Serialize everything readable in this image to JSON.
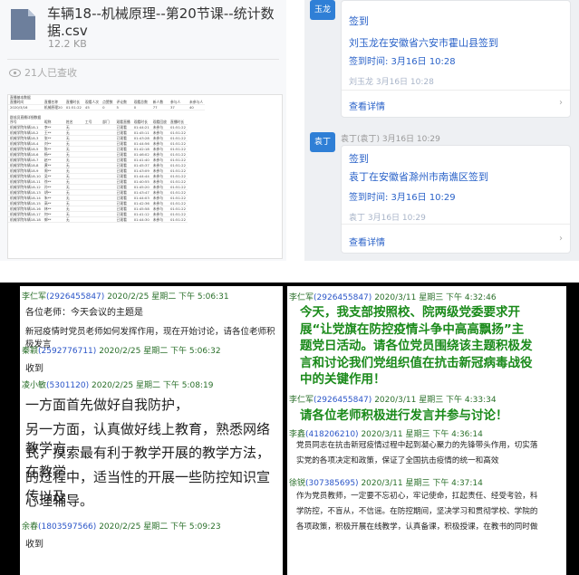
{
  "file_card": {
    "title": "车辆18--机械原理--第20节课--统计数据.csv",
    "size": "12.2 KB",
    "viewed": "21人已查收",
    "icon": "document-icon"
  },
  "spreadsheet": {
    "section1_title": "直播基本数据",
    "header1": [
      "直播时间",
      "直播名称",
      "直播时长",
      "观看人次",
      "点赞数",
      "评论数",
      "观看总数",
      "新人数",
      "参与人",
      "未参与人"
    ],
    "row1": [
      "2020/3/16",
      "机械原理20",
      "01:51:22",
      "45",
      "0",
      "5",
      "0",
      "77",
      "37",
      "40"
    ],
    "section2_title": "群成员直播详细数据",
    "header2": [
      "序号",
      "昵称",
      "姓名",
      "工号",
      "部门",
      "观看直播",
      "观看时长",
      "观看回放",
      "直播时长"
    ],
    "rows2": [
      [
        "机械学院车辆18-1",
        "李**",
        "无",
        "",
        "",
        "已观看",
        "01:44:21",
        "未参与",
        "01:51:22"
      ],
      [
        "机械学院车辆18-2",
        "王**",
        "无",
        "",
        "",
        "已观看",
        "01:45:11",
        "未参与",
        "01:51:22"
      ],
      [
        "机械学院车辆18-3",
        "张**",
        "无",
        "",
        "",
        "已观看",
        "01:43:28",
        "未参与",
        "01:51:22"
      ],
      [
        "机械学院车辆18-4",
        "刘**",
        "无",
        "",
        "",
        "已观看",
        "01:44:56",
        "未参与",
        "01:51:22"
      ],
      [
        "机械学院车辆18-5",
        "陈**",
        "无",
        "",
        "",
        "已观看",
        "01:42:18",
        "未参与",
        "01:51:22"
      ],
      [
        "机械学院车辆18-6",
        "杨**",
        "无",
        "",
        "",
        "已观看",
        "01:46:02",
        "未参与",
        "01:51:22"
      ],
      [
        "机械学院车辆18-7",
        "赵**",
        "无",
        "",
        "",
        "已观看",
        "01:41:40",
        "未参与",
        "01:51:22"
      ],
      [
        "机械学院车辆18-8",
        "黄**",
        "无",
        "",
        "",
        "已观看",
        "01:45:37",
        "未参与",
        "01:51:22"
      ],
      [
        "机械学院车辆18-9",
        "周**",
        "无",
        "",
        "",
        "已观看",
        "01:43:09",
        "未参与",
        "01:51:22"
      ],
      [
        "机械学院车辆18-10",
        "吴**",
        "无",
        "",
        "",
        "已观看",
        "01:44:44",
        "未参与",
        "01:51:22"
      ],
      [
        "机械学院车辆18-11",
        "徐**",
        "无",
        "",
        "",
        "已观看",
        "01:40:55",
        "未参与",
        "01:51:22"
      ],
      [
        "机械学院车辆18-12",
        "孙**",
        "无",
        "",
        "",
        "已观看",
        "01:45:20",
        "未参与",
        "01:51:22"
      ],
      [
        "机械学院车辆18-13",
        "胡**",
        "无",
        "",
        "",
        "已观看",
        "01:43:47",
        "未参与",
        "01:51:22"
      ],
      [
        "机械学院车辆18-14",
        "朱**",
        "无",
        "",
        "",
        "已观看",
        "01:44:03",
        "未参与",
        "01:51:22"
      ],
      [
        "机械学院车辆18-15",
        "高**",
        "无",
        "",
        "",
        "已观看",
        "01:42:36",
        "未参与",
        "01:51:22"
      ],
      [
        "机械学院车辆18-16",
        "林**",
        "无",
        "",
        "",
        "已观看",
        "01:45:58",
        "未参与",
        "01:51:22"
      ],
      [
        "机械学院车辆18-17",
        "何**",
        "无",
        "",
        "",
        "已观看",
        "01:41:12",
        "未参与",
        "01:51:22"
      ],
      [
        "机械学院车辆18-18",
        "郭**",
        "无",
        "",
        "",
        "已观看",
        "01:44:30",
        "未参与",
        "01:51:22"
      ]
    ]
  },
  "signin_cards": [
    {
      "avatar": "玉龙",
      "title": "签到",
      "main": "刘玉龙在安徽省六安市霍山县签到",
      "time": "签到时间: 3月16日 10:28",
      "time2": "刘玉龙 3月16日 10:28",
      "link": "查看详情"
    },
    {
      "avatar": "袁丁",
      "sender": "袁丁(袁丁)  3月16日 10:29",
      "title": "签到",
      "main": "袁丁在安徽省滁州市南谯区签到",
      "time": "签到时间: 3月16日 10:29",
      "time2": "袁丁 3月16日 10:29",
      "link": "查看详情"
    }
  ],
  "chat_left": [
    {
      "name": "李仁军",
      "qq": "(2926455847)",
      "time": "2020/2/25 星期二 下午 5:06:31",
      "lines": [
        "各位老师：今天会议的主题是",
        "新冠疫情时党员老师如何发挥作用，现在开始讨论，请各位老师积极发言"
      ]
    },
    {
      "name": "秦颖",
      "qq": "(2592776711)",
      "time": "2020/2/25 星期二 下午 5:06:32",
      "lines": [
        "收到"
      ]
    },
    {
      "name": "凌小敏",
      "qq": "(5301120)",
      "time": "2020/2/25 星期二 下午 5:08:19",
      "lines": [
        "一方面首先做好自我防护，",
        "另一方面，认真做好线上教育，熟悉网络教学方",
        "式，摸索最有利于教学开展的教学方法，在教学",
        "的过程中，适当性的开展一些防控知识宣传以及",
        "心理辅导。"
      ]
    },
    {
      "name": "余春",
      "qq": "(1803597566)",
      "time": "2020/2/25 星期二 下午 5:09:23",
      "lines": [
        "收到"
      ]
    }
  ],
  "chat_right": [
    {
      "name": "李仁军",
      "qq": "(2926455847)",
      "time": "2020/3/11 星期三 下午 4:32:46",
      "lines": [
        "今天，我支部按照校、院两级党委要求开",
        "展“让党旗在防控疫情斗争中高高飘扬”主",
        "题党日活动。请各位党员围绕该主题积极发",
        "言和讨论我们党组织值在抗击新冠病毒战役",
        "中的关键作用！"
      ]
    },
    {
      "name": "李仁军",
      "qq": "(2926455847)",
      "time": "2020/3/11 星期三 下午 4:33:34",
      "lines": [
        "请各位老师积极进行发言并参与讨论！"
      ]
    },
    {
      "name": "李鑫",
      "qq": "(418206210)",
      "time": "2020/3/11 星期三 下午 4:36:14",
      "lines": [
        "党员同志在抗击新冠疫情过程中起到凝心聚力的先锋带头作用，切实落",
        "实党的各项决定和政策，保证了全国抗击疫情的统一和高效"
      ]
    },
    {
      "name": "徐锐",
      "qq": "(307385695)",
      "time": "2020/3/11 星期三 下午 4:37:14",
      "lines": [
        "作为党员教师，一定要不忘初心，牢记使命，扛起责任、经受考验，科",
        "学防控，不盲从，不信谣。在防控期间，坚决学习和贯彻学校、学院的",
        "各项政策，积极开展在线教学，认真备课，积极授课，在教书的同时做"
      ]
    }
  ]
}
